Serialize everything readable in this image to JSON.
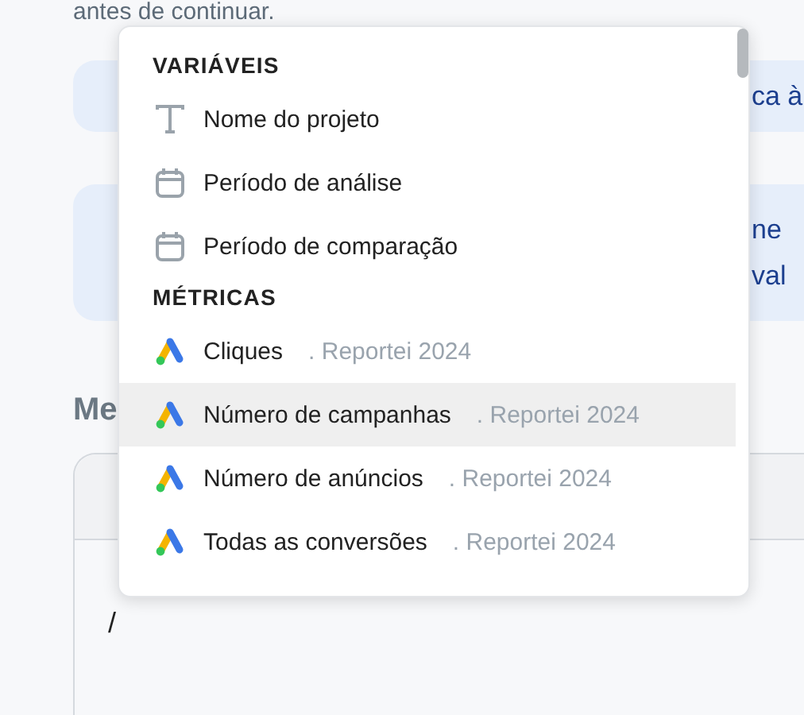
{
  "page": {
    "intro_text": "antes de continuar.",
    "notices": [
      {
        "lines": [
          "ca à"
        ]
      },
      {
        "lines": [
          "ne",
          "val"
        ]
      }
    ],
    "section_label": "Me",
    "editor": {
      "content": "/"
    }
  },
  "dropdown": {
    "sections": [
      {
        "title": "VARIÁVEIS",
        "items": [
          {
            "kind": "text",
            "label": "Nome do projeto",
            "highlighted": false
          },
          {
            "kind": "calendar",
            "label": "Período de análise",
            "highlighted": false
          },
          {
            "kind": "calendar",
            "label": "Período de comparação",
            "highlighted": false
          }
        ]
      },
      {
        "title": "MÉTRICAS",
        "items": [
          {
            "kind": "ads",
            "label": "Cliques",
            "source": ". Reportei 2024",
            "highlighted": false
          },
          {
            "kind": "ads",
            "label": "Número de campanhas",
            "source": ". Reportei 2024",
            "highlighted": true
          },
          {
            "kind": "ads",
            "label": "Número de anúncios",
            "source": ". Reportei 2024",
            "highlighted": false
          },
          {
            "kind": "ads",
            "label": "Todas as conversões",
            "source": ". Reportei 2024",
            "highlighted": false
          }
        ]
      }
    ]
  }
}
